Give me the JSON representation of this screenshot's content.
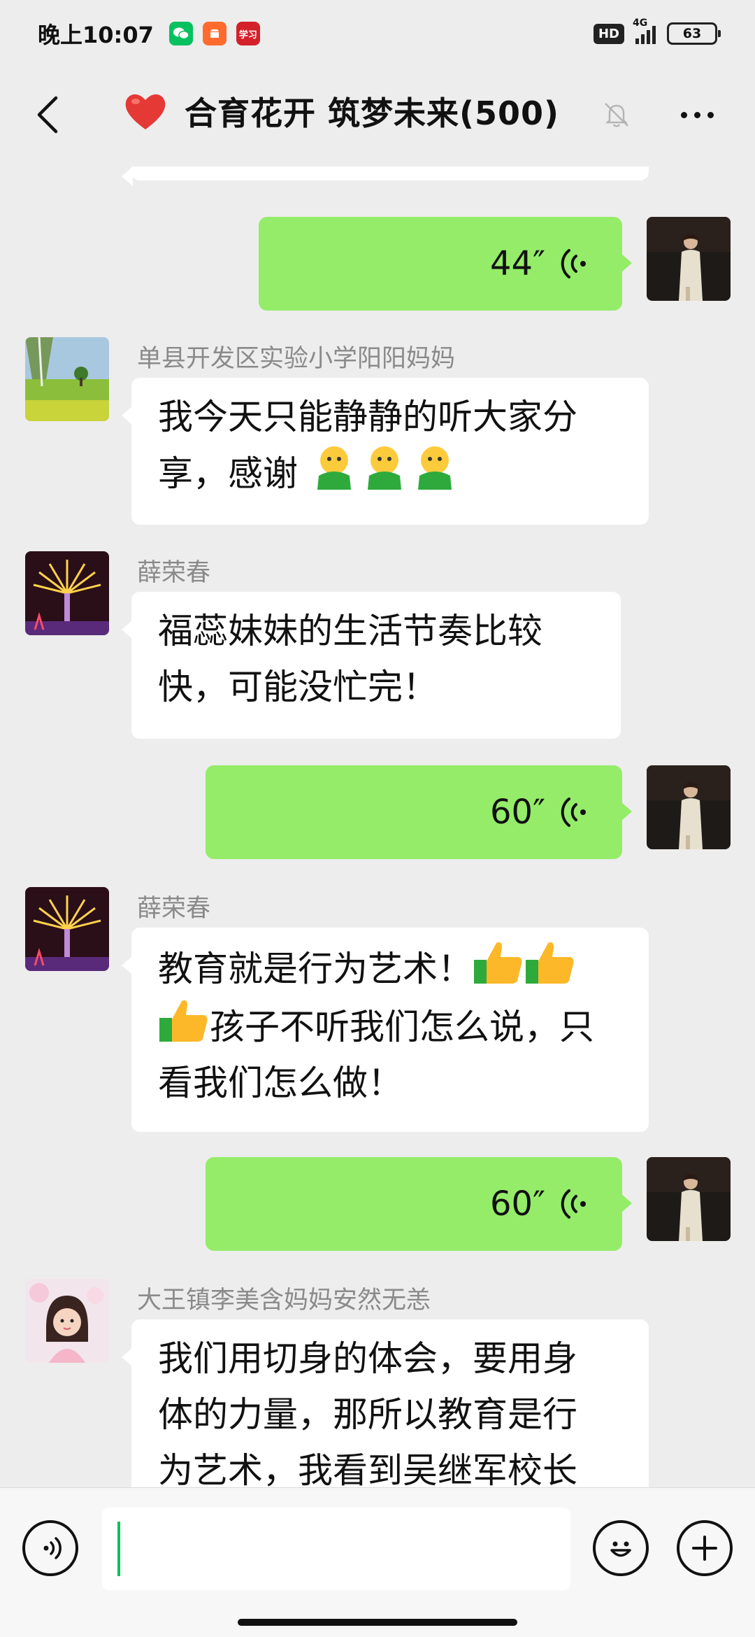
{
  "status_bar": {
    "time": "晚上10:07",
    "network": "4G",
    "battery": "63",
    "hd": "HD",
    "study_app_glyph": "学习"
  },
  "header": {
    "title": "合育花开 筑梦未来(500)",
    "heart_color": "#E53935"
  },
  "messages": [
    {
      "type": "voice",
      "side": "right",
      "duration": "44″"
    },
    {
      "type": "text",
      "side": "left",
      "sender": "单县开发区实验小学阳阳妈妈",
      "lines": [
        "我今天只能静静的听大家分",
        "享，感谢"
      ],
      "trailing_emoji_count": 3
    },
    {
      "type": "text",
      "side": "left",
      "sender": "薛荣春",
      "lines": [
        "福蕊妹妹的生活节奏比较",
        "快，可能没忙完！"
      ]
    },
    {
      "type": "voice",
      "side": "right",
      "duration": "60″"
    },
    {
      "type": "text",
      "side": "left",
      "sender": "薛荣春",
      "lines": [
        "教育就是行为艺术！",
        "孩子不听我们怎么说，只",
        "看我们怎么做！"
      ]
    },
    {
      "type": "voice",
      "side": "right",
      "duration": "60″"
    },
    {
      "type": "text",
      "side": "left",
      "sender": "大王镇李美含妈妈安然无恙",
      "lines": [
        "我们用切身的体会，要用身",
        "体的力量，那所以教育是行",
        "为艺术，我看到吴继军校长"
      ]
    }
  ],
  "colors": {
    "self_bubble": "#95EC69",
    "other_bubble": "#FFFFFF",
    "background": "#EDEDED",
    "accent": "#07C160"
  },
  "input": {
    "value": ""
  }
}
